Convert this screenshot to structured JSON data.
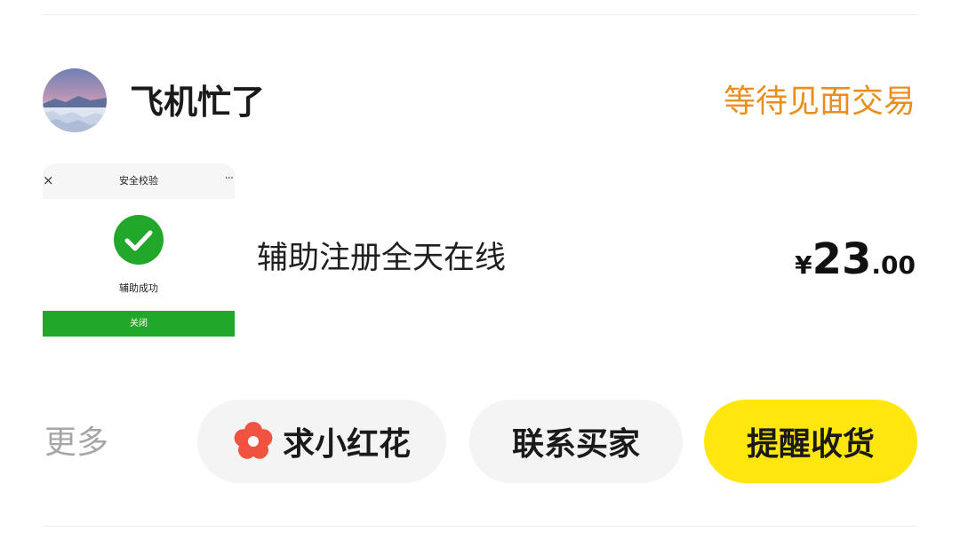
{
  "seller": {
    "name": "飞机忙了",
    "status": "等待见面交易"
  },
  "item": {
    "title": "辅助注册全天在线",
    "price": {
      "currency": "¥",
      "integer": "23",
      "decimal": ".00"
    },
    "thumbnail": {
      "close_glyph": "×",
      "header_title": "安全校验",
      "more_glyph": "···",
      "message": "辅助成功",
      "button_label": "关闭"
    }
  },
  "actions": {
    "more_label": "更多",
    "flower_label": "求小红花",
    "contact_label": "联系买家",
    "remind_label": "提醒收货"
  },
  "colors": {
    "status": "#e88f1e",
    "primary_button": "#ffe60f",
    "secondary_button": "#f4f4f4",
    "flower_icon": "#f0533f",
    "success_green": "#21a82a"
  }
}
